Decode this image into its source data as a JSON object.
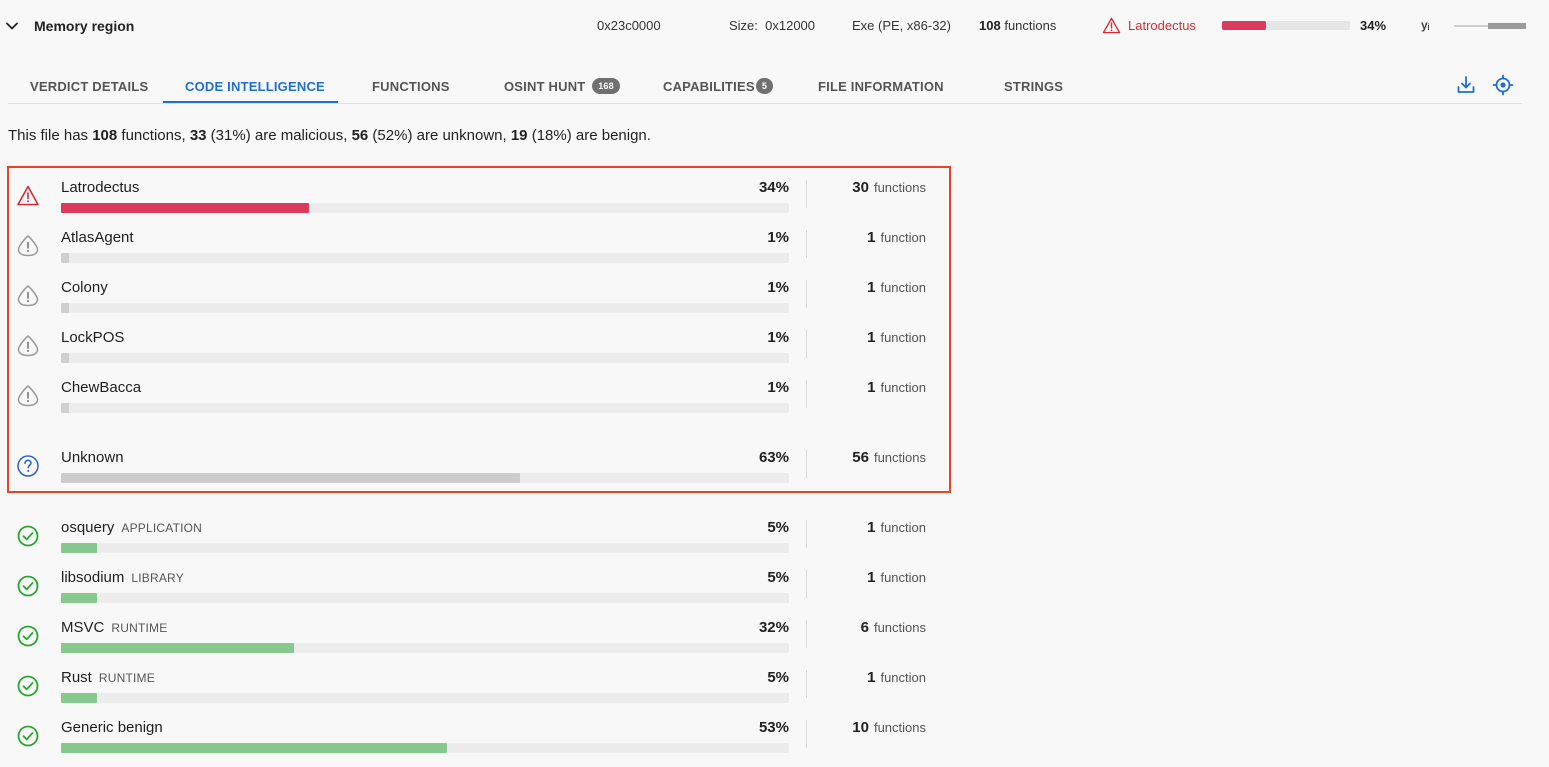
{
  "header": {
    "title": "Memory region",
    "address": "0x23c0000",
    "size_label": "Size:",
    "size_value": "0x12000",
    "file_type": "Exe (PE, x86-32)",
    "functions_count": "108",
    "functions_label": "functions",
    "family": "Latrodectus",
    "family_percent": 34,
    "family_percent_label": "34%",
    "mini_icon": "yᵢ",
    "colors": {
      "malicious": "#d72c37",
      "malicious_bar": "#d93a5e",
      "active_tab": "#1f6fd0"
    }
  },
  "tabs": [
    {
      "label": "VERDICT DETAILS",
      "active": false
    },
    {
      "label": "CODE INTELLIGENCE",
      "active": true
    },
    {
      "label": "FUNCTIONS",
      "active": false
    },
    {
      "label": "OSINT HUNT",
      "badge": "168",
      "active": false
    },
    {
      "label": "CAPABILITIES",
      "badge": "5",
      "active": false
    },
    {
      "label": "FILE INFORMATION",
      "active": false
    },
    {
      "label": "STRINGS",
      "active": false
    }
  ],
  "toolbar": {
    "icons": [
      "download-icon",
      "target-icon"
    ]
  },
  "summary": {
    "prefix": "This file has",
    "total": "108",
    "t1": "functions,",
    "malicious": "33",
    "t2": "(31%) are malicious,",
    "unknown": "56",
    "t3": "(52%) are unknown,",
    "benign": "19",
    "t4": "(18%) are benign."
  },
  "rows": [
    {
      "name": "Latrodectus",
      "tag": "",
      "pct_label": "34%",
      "pct": 34,
      "count": "30",
      "unit": "functions",
      "kind": "malicious",
      "color": "#d93a5e"
    },
    {
      "name": "AtlasAgent",
      "tag": "",
      "pct_label": "1%",
      "pct": 1,
      "count": "1",
      "unit": "function",
      "kind": "suspicious",
      "color": "#cfcfcf"
    },
    {
      "name": "Colony",
      "tag": "",
      "pct_label": "1%",
      "pct": 1,
      "count": "1",
      "unit": "function",
      "kind": "suspicious",
      "color": "#cfcfcf"
    },
    {
      "name": "LockPOS",
      "tag": "",
      "pct_label": "1%",
      "pct": 1,
      "count": "1",
      "unit": "function",
      "kind": "suspicious",
      "color": "#cfcfcf"
    },
    {
      "name": "ChewBacca",
      "tag": "",
      "pct_label": "1%",
      "pct": 1,
      "count": "1",
      "unit": "function",
      "kind": "suspicious",
      "color": "#cfcfcf"
    },
    {
      "name": "Unknown",
      "tag": "",
      "pct_label": "63%",
      "pct": 63,
      "count": "56",
      "unit": "functions",
      "kind": "unknown",
      "color": "#cccccc"
    },
    {
      "name": "osquery",
      "tag": "APPLICATION",
      "pct_label": "5%",
      "pct": 5,
      "count": "1",
      "unit": "function",
      "kind": "benign",
      "color": "#86c98e"
    },
    {
      "name": "libsodium",
      "tag": "LIBRARY",
      "pct_label": "5%",
      "pct": 5,
      "count": "1",
      "unit": "function",
      "kind": "benign",
      "color": "#86c98e"
    },
    {
      "name": "MSVC",
      "tag": "RUNTIME",
      "pct_label": "32%",
      "pct": 32,
      "count": "6",
      "unit": "functions",
      "kind": "benign",
      "color": "#86c98e"
    },
    {
      "name": "Rust",
      "tag": "RUNTIME",
      "pct_label": "5%",
      "pct": 5,
      "count": "1",
      "unit": "function",
      "kind": "benign",
      "color": "#86c98e"
    },
    {
      "name": "Generic benign",
      "tag": "",
      "pct_label": "53%",
      "pct": 53,
      "count": "10",
      "unit": "functions",
      "kind": "benign",
      "color": "#86c98e"
    }
  ]
}
